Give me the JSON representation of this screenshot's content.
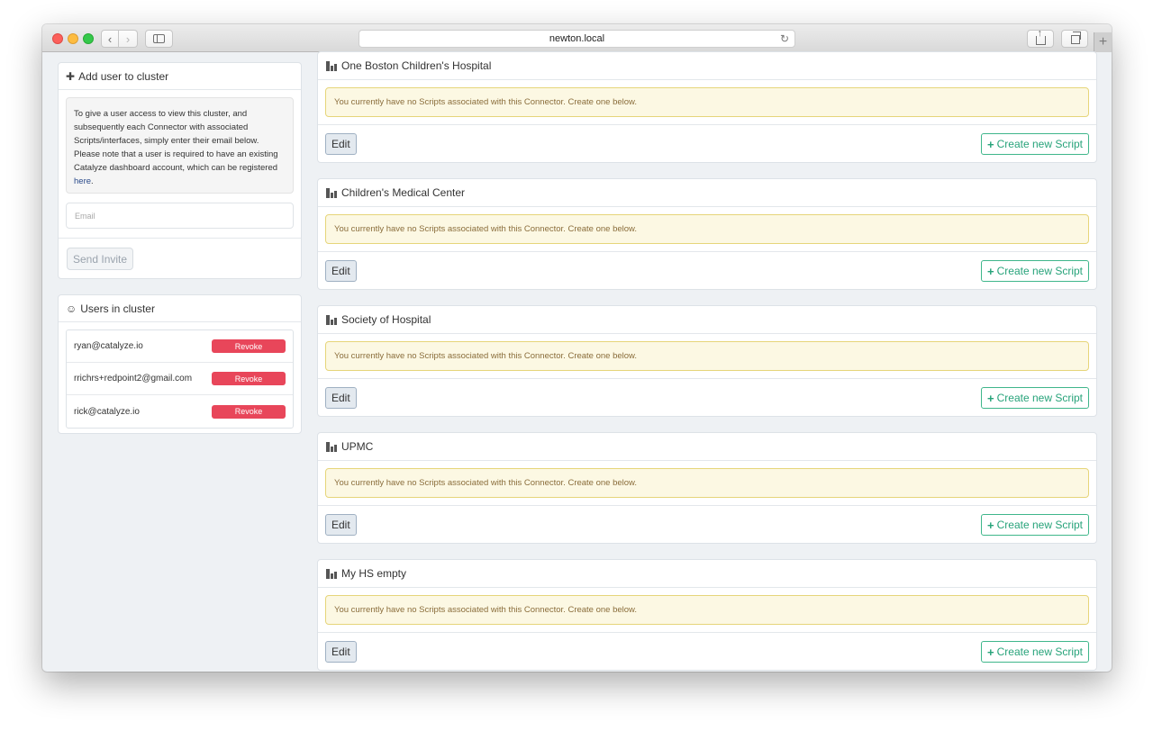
{
  "browser": {
    "url": "newton.local"
  },
  "add_user": {
    "title": "Add user to cluster",
    "info_text": "To give a user access to view this cluster, and subsequently each Connector with associated Scripts/interfaces, simply enter their email below. Please note that a user is required to have an existing Catalyze dashboard account, which can be registered",
    "info_link": "here",
    "info_end": ".",
    "email_placeholder": "Email",
    "send_label": "Send Invite"
  },
  "users": {
    "title": "Users in cluster",
    "revoke_label": "Revoke",
    "list": [
      "ryan@catalyze.io",
      "rrichrs+redpoint2@gmail.com",
      "rick@catalyze.io"
    ]
  },
  "connectors": [
    {
      "name": "One Boston Children's Hospital",
      "alert": "You currently have no Scripts associated with this Connector. Create one below.",
      "edit_label": "Edit",
      "create_label": "Create new Script"
    },
    {
      "name": "Children's Medical Center",
      "alert": "You currently have no Scripts associated with this Connector. Create one below.",
      "edit_label": "Edit",
      "create_label": "Create new Script"
    },
    {
      "name": "Society of Hospital",
      "alert": "You currently have no Scripts associated with this Connector. Create one below.",
      "edit_label": "Edit",
      "create_label": "Create new Script"
    },
    {
      "name": "UPMC",
      "alert": "You currently have no Scripts associated with this Connector. Create one below.",
      "edit_label": "Edit",
      "create_label": "Create new Script"
    },
    {
      "name": "My HS empty",
      "alert": "You currently have no Scripts associated with this Connector. Create one below.",
      "edit_label": "Edit",
      "create_label": "Create new Script"
    }
  ],
  "colors": {
    "revoke": "#e8465a",
    "create_accent": "#27a37a",
    "alert_bg": "#fcf8e3",
    "alert_text": "#8a6d3b"
  }
}
